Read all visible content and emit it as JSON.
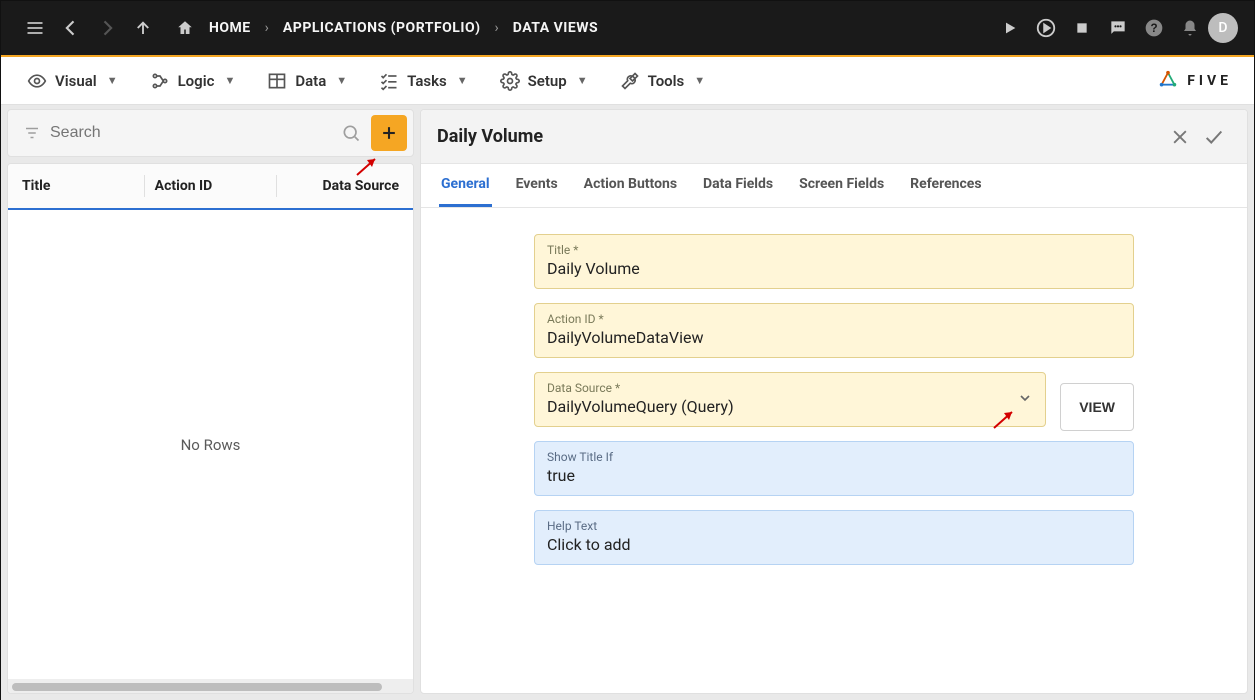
{
  "breadcrumbs": {
    "home": "HOME",
    "apps": "APPLICATIONS (PORTFOLIO)",
    "dataviews": "DATA VIEWS"
  },
  "menus": {
    "visual": "Visual",
    "logic": "Logic",
    "data": "Data",
    "tasks": "Tasks",
    "setup": "Setup",
    "tools": "Tools"
  },
  "brand": {
    "name": "FIVE"
  },
  "avatar": {
    "initial": "D"
  },
  "left": {
    "search_placeholder": "Search",
    "columns": {
      "title": "Title",
      "action_id": "Action ID",
      "data_source": "Data Source"
    },
    "empty": "No Rows"
  },
  "detail": {
    "title": "Daily Volume",
    "tabs": {
      "general": "General",
      "events": "Events",
      "action_buttons": "Action Buttons",
      "data_fields": "Data Fields",
      "screen_fields": "Screen Fields",
      "references": "References"
    },
    "fields": {
      "title": {
        "label": "Title *",
        "value": "Daily Volume"
      },
      "action_id": {
        "label": "Action ID *",
        "value": "DailyVolumeDataView"
      },
      "data_source": {
        "label": "Data Source *",
        "value": "DailyVolumeQuery (Query)",
        "view_button": "VIEW"
      },
      "show_title_if": {
        "label": "Show Title If",
        "value": "true"
      },
      "help_text": {
        "label": "Help Text",
        "value": "Click to add"
      }
    }
  }
}
